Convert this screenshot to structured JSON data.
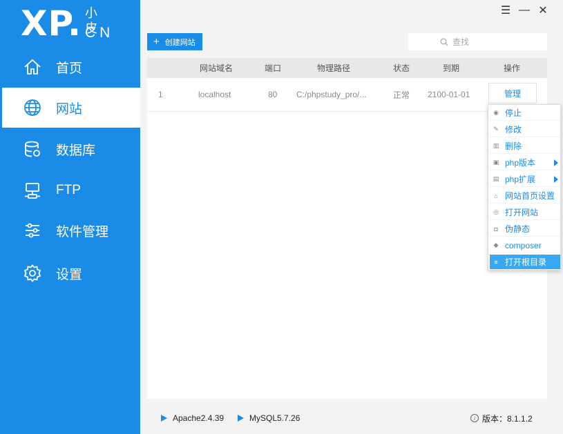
{
  "logo": {
    "main": "XP.",
    "cn": "小皮",
    "en": "CN"
  },
  "window": {
    "menu_icon": "☰",
    "min_icon": "—",
    "close_icon": "✕"
  },
  "nav": [
    {
      "label": "首页",
      "icon": "home-icon"
    },
    {
      "label": "网站",
      "icon": "globe-icon"
    },
    {
      "label": "数据库",
      "icon": "database-icon"
    },
    {
      "label": "FTP",
      "icon": "server-icon"
    },
    {
      "label": "软件管理",
      "icon": "sliders-icon"
    },
    {
      "label": "设置",
      "icon": "gear-icon"
    }
  ],
  "toolbar": {
    "create_label": "创建网站",
    "search_placeholder": "查找"
  },
  "table": {
    "headers": [
      "网站域名",
      "端口",
      "物理路径",
      "状态",
      "到期",
      "操作"
    ],
    "rows": [
      {
        "index": "1",
        "domain": "localhost",
        "port": "80",
        "path": "C:/phpstudy_pro/...",
        "status": "正常",
        "expire": "2100-01-01",
        "action": "管理"
      }
    ]
  },
  "menu": [
    {
      "label": "停止",
      "icon": "stop-icon"
    },
    {
      "label": "修改",
      "icon": "edit-icon"
    },
    {
      "label": "删除",
      "icon": "trash-icon"
    },
    {
      "label": "php版本",
      "icon": "php-version-icon",
      "submenu": true
    },
    {
      "label": "php扩展",
      "icon": "php-extension-icon",
      "submenu": true
    },
    {
      "label": "网站首页设置",
      "icon": "home-settings-icon"
    },
    {
      "label": "打开网站",
      "icon": "open-site-icon"
    },
    {
      "label": "伪静态",
      "icon": "rewrite-icon"
    },
    {
      "label": "composer",
      "icon": "composer-icon"
    },
    {
      "label": "打开根目录",
      "icon": "folder-icon",
      "highlighted": true
    }
  ],
  "footer": {
    "apache": "Apache2.4.39",
    "mysql": "MySQL5.7.26",
    "version": "版本：8.1.1.2"
  },
  "colors": {
    "primary": "#1a8ce8",
    "highlight": "#37a9f4"
  }
}
